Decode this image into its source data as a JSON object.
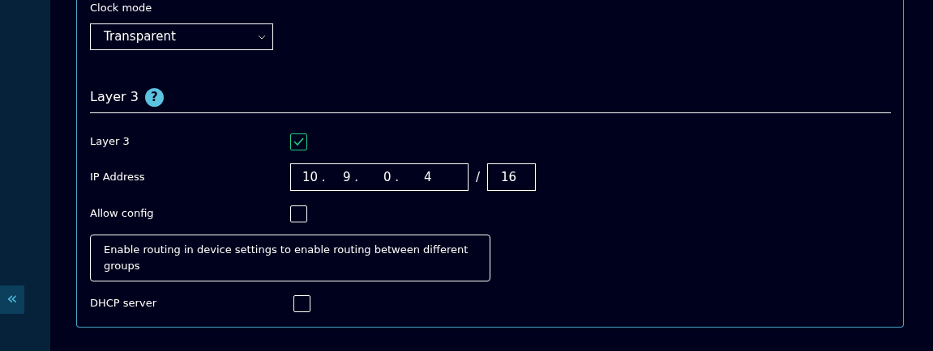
{
  "clock_mode": {
    "label": "Clock mode",
    "value": "Transparent"
  },
  "section": {
    "title": "Layer 3",
    "help_icon": "?"
  },
  "layer3": {
    "label": "Layer 3",
    "checked": true
  },
  "ip_address": {
    "label": "IP Address",
    "octets": [
      "10",
      "9",
      "0",
      "4"
    ],
    "octet_separator": ".",
    "separator": "/",
    "prefix": "16"
  },
  "allow_config": {
    "label": "Allow config",
    "checked": false
  },
  "notice": "Enable routing in device settings to enable routing between different groups",
  "dhcp_server": {
    "label": "DHCP server",
    "checked": false
  },
  "sidebar": {
    "collapse_button": "«"
  }
}
